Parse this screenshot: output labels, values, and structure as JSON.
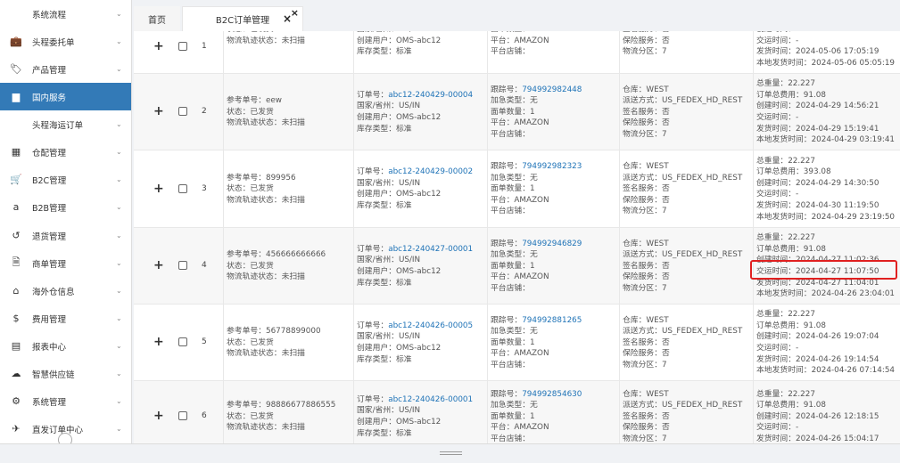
{
  "sidebar": {
    "items": [
      {
        "label": "系统流程",
        "icon": "none",
        "glyph": "",
        "top": 0,
        "sub": true
      },
      {
        "label": "头程委托单",
        "icon": "briefcase-icon",
        "glyph": "💼"
      },
      {
        "label": "产品管理",
        "icon": "tag-icon",
        "glyph": "🏷"
      },
      {
        "label": "国内服务",
        "icon": "folder-icon",
        "glyph": "▆",
        "active": true
      },
      {
        "label": "头程海运订单",
        "icon": "none",
        "glyph": "",
        "sub": true
      },
      {
        "label": "仓配管理",
        "icon": "grid-icon",
        "glyph": "▦"
      },
      {
        "label": "B2C管理",
        "icon": "cart-icon",
        "glyph": "🛒"
      },
      {
        "label": "B2B管理",
        "icon": "amazon-icon",
        "glyph": "a"
      },
      {
        "label": "退货管理",
        "icon": "return-icon",
        "glyph": "↺"
      },
      {
        "label": "商单管理",
        "icon": "document-icon",
        "glyph": "🗎"
      },
      {
        "label": "海外仓信息",
        "icon": "home-icon",
        "glyph": "⌂"
      },
      {
        "label": "费用管理",
        "icon": "dollar-icon",
        "glyph": "$"
      },
      {
        "label": "报表中心",
        "icon": "table-icon",
        "glyph": "▤"
      },
      {
        "label": "智慧供应链",
        "icon": "cloud-icon",
        "glyph": "☁"
      },
      {
        "label": "系统管理",
        "icon": "gear-icon",
        "glyph": "⚙"
      },
      {
        "label": "直发订单中心",
        "icon": "plane-icon",
        "glyph": "✈"
      }
    ]
  },
  "tabs": {
    "home": "首页",
    "b2c": "B2C订单管理",
    "close_mark": "×",
    "close_all": "×"
  },
  "rows": [
    {
      "num": "1",
      "col_ref": [
        "状态：已发货",
        "物流轨迹状态：未扫描"
      ],
      "col_order": [
        "国家/省州：US/IN",
        "创建用户：OMS-abc12",
        "库存类型：标准"
      ],
      "col_track": [
        "面单数量：1",
        "平台：AMAZON",
        "平台店铺："
      ],
      "col_wh": [
        "签名服务：否",
        "保险服务：否",
        "物流分区：7"
      ],
      "col_time": [
        "创建时间：2024-05-06 17:03:23",
        "交运时间：-",
        "发货时间：2024-05-06 17:05:19",
        "本地发货时间：2024-05-06 05:05:19"
      ]
    },
    {
      "num": "2",
      "col_ref": [
        "参考单号：eew",
        "状态：已发货",
        "物流轨迹状态：未扫描"
      ],
      "order_no": "abc12-240429-00004",
      "col_order": [
        "国家/省州：US/IN",
        "创建用户：OMS-abc12",
        "库存类型：标准"
      ],
      "track_no": "794992982448",
      "col_track": [
        "加急类型：无",
        "面单数量：1",
        "平台：AMAZON",
        "平台店铺："
      ],
      "col_wh": [
        "仓库：WEST",
        "派送方式：US_FEDEX_HD_REST",
        "签名服务：否",
        "保险服务：否",
        "物流分区：7"
      ],
      "col_time": [
        "总重量：22.227",
        "订单总费用：91.08",
        "创建时间：2024-04-29 14:56:21",
        "交运时间：-",
        "发货时间：2024-04-29 15:19:41",
        "本地发货时间：2024-04-29 03:19:41"
      ]
    },
    {
      "num": "3",
      "col_ref": [
        "参考单号：899956",
        "状态：已发货",
        "物流轨迹状态：未扫描"
      ],
      "order_no": "abc12-240429-00002",
      "col_order": [
        "国家/省州：US/IN",
        "创建用户：OMS-abc12",
        "库存类型：标准"
      ],
      "track_no": "794992982323",
      "col_track": [
        "加急类型：无",
        "面单数量：1",
        "平台：AMAZON",
        "平台店铺："
      ],
      "col_wh": [
        "仓库：WEST",
        "派送方式：US_FEDEX_HD_REST",
        "签名服务：否",
        "保险服务：否",
        "物流分区：7"
      ],
      "col_time": [
        "总重量：22.227",
        "订单总费用：393.08",
        "创建时间：2024-04-29 14:30:50",
        "交运时间：-",
        "发货时间：2024-04-30 11:19:50",
        "本地发货时间：2024-04-29 23:19:50"
      ]
    },
    {
      "num": "4",
      "col_ref": [
        "参考单号：456666666666",
        "状态：已发货",
        "物流轨迹状态：未扫描"
      ],
      "order_no": "abc12-240427-00001",
      "col_order": [
        "国家/省州：US/IN",
        "创建用户：OMS-abc12",
        "库存类型：标准"
      ],
      "track_no": "794992946829",
      "col_track": [
        "加急类型：无",
        "面单数量：1",
        "平台：AMAZON",
        "平台店铺："
      ],
      "col_wh": [
        "仓库：WEST",
        "派送方式：US_FEDEX_HD_REST",
        "签名服务：否",
        "保险服务：否",
        "物流分区：7"
      ],
      "col_time": [
        "总重量：22.227",
        "订单总费用：91.08",
        "创建时间：2024-04-27 11:02:36",
        "交运时间：2024-04-27 11:07:50",
        "发货时间：2024-04-27 11:04:01",
        "本地发货时间：2024-04-26 23:04:01"
      ]
    },
    {
      "num": "5",
      "col_ref": [
        "参考单号：56778899000",
        "状态：已发货",
        "物流轨迹状态：未扫描"
      ],
      "order_no": "abc12-240426-00005",
      "col_order": [
        "国家/省州：US/IN",
        "创建用户：OMS-abc12",
        "库存类型：标准"
      ],
      "track_no": "794992881265",
      "col_track": [
        "加急类型：无",
        "面单数量：1",
        "平台：AMAZON",
        "平台店铺："
      ],
      "col_wh": [
        "仓库：WEST",
        "派送方式：US_FEDEX_HD_REST",
        "签名服务：否",
        "保险服务：否",
        "物流分区：7"
      ],
      "col_time": [
        "总重量：22.227",
        "订单总费用：91.08",
        "创建时间：2024-04-26 19:07:04",
        "交运时间：-",
        "发货时间：2024-04-26 19:14:54",
        "本地发货时间：2024-04-26 07:14:54"
      ]
    },
    {
      "num": "6",
      "col_ref": [
        "参考单号：98886677886555",
        "状态：已发货",
        "物流轨迹状态：未扫描"
      ],
      "order_no": "abc12-240426-00001",
      "col_order": [
        "国家/省州：US/IN",
        "创建用户：OMS-abc12",
        "库存类型：标准"
      ],
      "track_no": "794992854630",
      "col_track": [
        "加急类型：无",
        "面单数量：1",
        "平台：AMAZON",
        "平台店铺："
      ],
      "col_wh": [
        "仓库：WEST",
        "派送方式：US_FEDEX_HD_REST",
        "签名服务：否",
        "保险服务：否",
        "物流分区：7"
      ],
      "col_time": [
        "总重量：22.227",
        "订单总费用：91.08",
        "创建时间：2024-04-26 12:18:15",
        "交运时间：-",
        "发货时间：2024-04-26 15:04:17"
      ]
    }
  ],
  "labels": {
    "order_no_prefix": "订单号：",
    "track_no_prefix": "跟踪号："
  },
  "colors": {
    "active_sidebar": "#337ab7",
    "link": "#1f73b7",
    "highlight_box": "#e02020"
  }
}
